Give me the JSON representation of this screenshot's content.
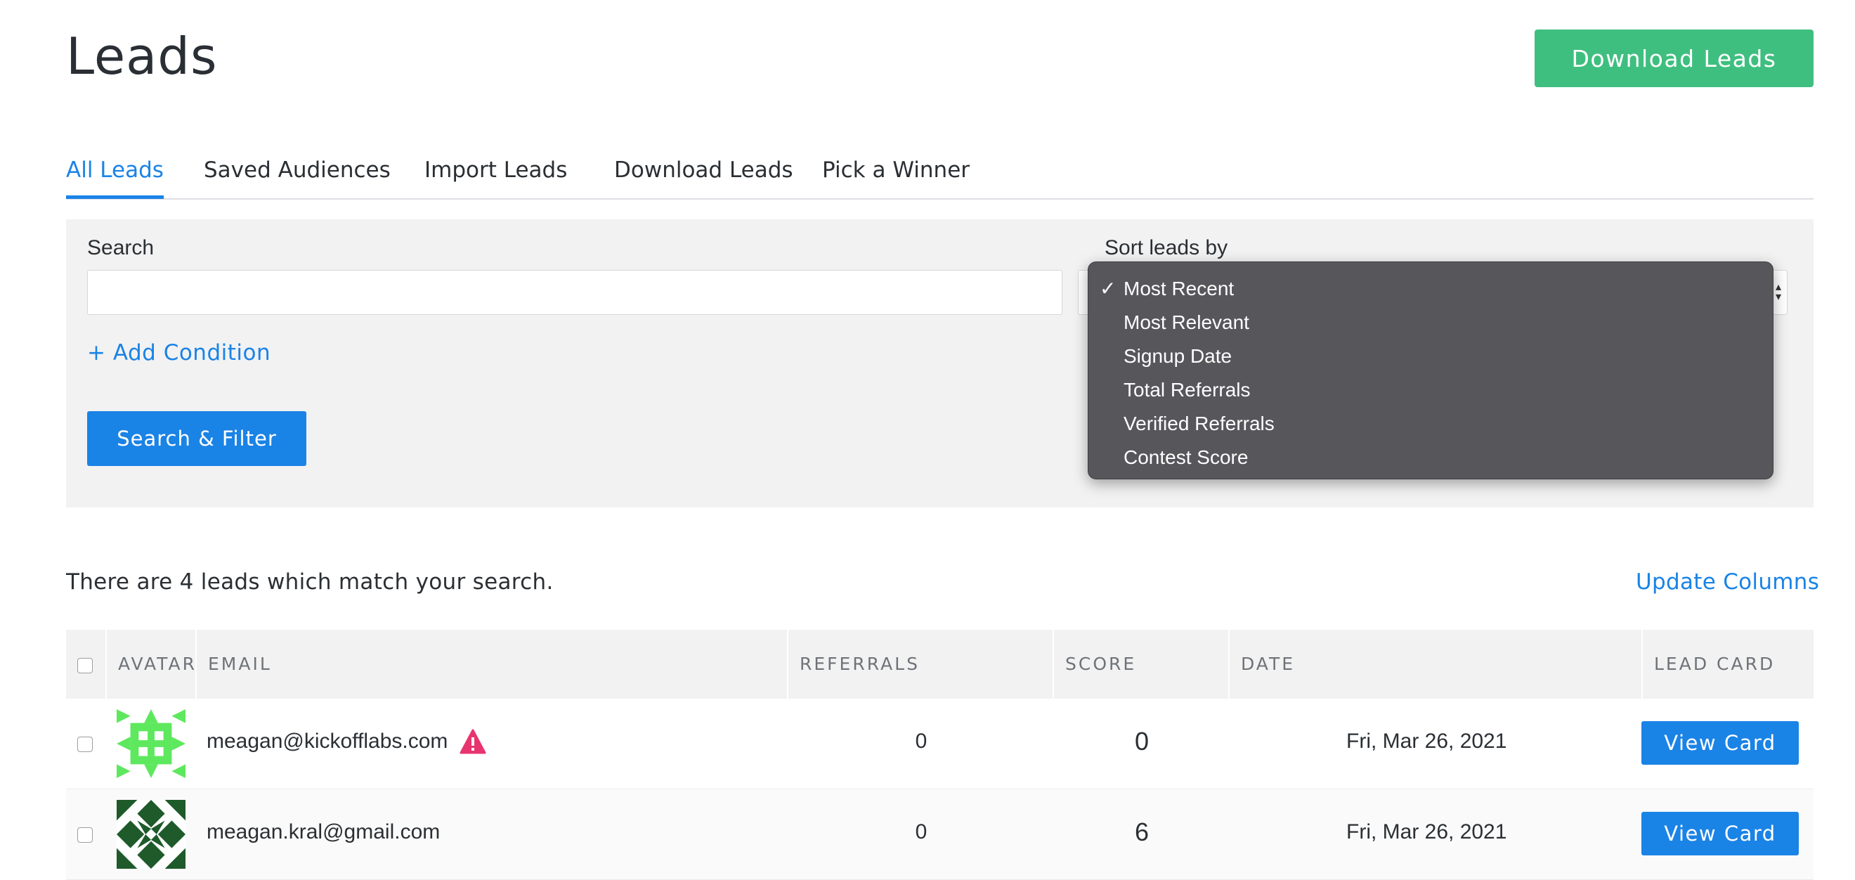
{
  "header": {
    "title": "Leads",
    "download_button": "Download Leads"
  },
  "tabs": [
    {
      "label": "All Leads",
      "active": true
    },
    {
      "label": "Saved Audiences",
      "active": false
    },
    {
      "label": "Import Leads",
      "active": false
    },
    {
      "label": "Download Leads",
      "active": false
    },
    {
      "label": "Pick a Winner",
      "active": false
    }
  ],
  "filter": {
    "search_label": "Search",
    "search_value": "",
    "add_condition": "+ Add Condition",
    "search_button": "Search & Filter",
    "sort_label": "Sort leads by",
    "sort_selected": "Most Recent",
    "sort_options": [
      {
        "label": "Most Recent",
        "checked": true
      },
      {
        "label": "Most Relevant",
        "checked": false
      },
      {
        "label": "Signup Date",
        "checked": false
      },
      {
        "label": "Total Referrals",
        "checked": false
      },
      {
        "label": "Verified Referrals",
        "checked": false
      },
      {
        "label": "Contest Score",
        "checked": false
      }
    ],
    "check_glyph": "✓"
  },
  "results": {
    "summary": "There are 4 leads which match your search.",
    "update_columns": "Update Columns"
  },
  "table": {
    "headers": {
      "avatar": "AVATAR",
      "email": "EMAIL",
      "referrals": "REFERRALS",
      "score": "SCORE",
      "date": "DATE",
      "lead_card": "LEAD CARD"
    },
    "rows": [
      {
        "email": "meagan@kickofflabs.com",
        "warning": true,
        "warning_icon": "warning-triangle-icon",
        "referrals": "0",
        "score": "0",
        "date": "Fri, Mar 26, 2021",
        "button": "View Card",
        "avatar_color": "#5ee85e"
      },
      {
        "email": "meagan.kral@gmail.com",
        "warning": false,
        "referrals": "0",
        "score": "6",
        "date": "Fri, Mar 26, 2021",
        "button": "View Card",
        "avatar_color": "#1e5a2a"
      }
    ]
  },
  "colors": {
    "accent_blue": "#1a83e6",
    "download_green": "#3fbf7f",
    "warning_pink": "#e8346f"
  }
}
